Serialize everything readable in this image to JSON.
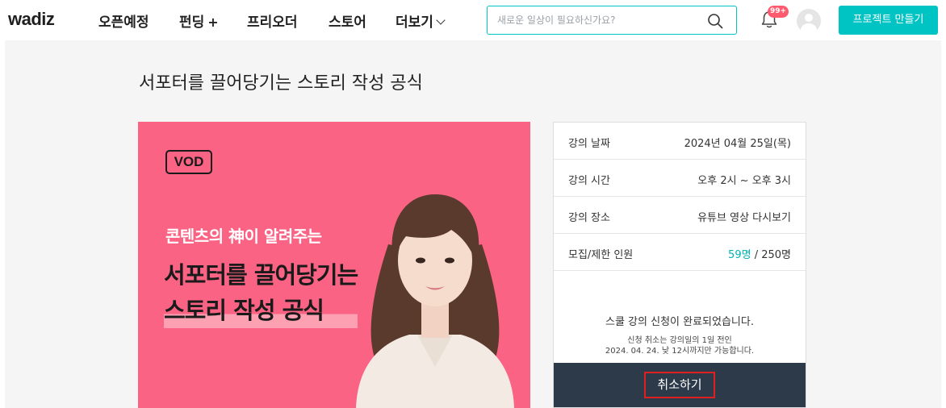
{
  "header": {
    "logo": "wadiz",
    "nav": [
      {
        "label": "오픈예정"
      },
      {
        "label": "펀딩"
      },
      {
        "label": "프리오더"
      },
      {
        "label": "스토어"
      },
      {
        "label": "더보기"
      }
    ],
    "funding_plus": "+",
    "search": {
      "placeholder": "새로운 일상이 필요하신가요?",
      "value": ""
    },
    "notification_badge": "99+",
    "create_button": "프로젝트 만들기"
  },
  "page": {
    "title": "서포터를 끌어당기는 스토리 작성 공식"
  },
  "banner": {
    "tag": "VOD",
    "subheadline": "콘텐츠의 神이 알려주는",
    "headline_line1": "서포터를 끌어당기는",
    "headline_line2": "스토리 작성 공식"
  },
  "lecture_info": {
    "rows": [
      {
        "label": "강의 날짜",
        "value": "2024년 04월 25일(목)"
      },
      {
        "label": "강의 시간",
        "value": "오후 2시 ~ 오후 3시"
      },
      {
        "label": "강의 장소",
        "value": "유튜브 영상 다시보기"
      },
      {
        "label": "모집/제한 인원",
        "value_current": "59명",
        "value_sep": " / ",
        "value_limit": "250명"
      }
    ],
    "notice_main": "스쿨 강의 신청이 완료되었습니다.",
    "notice_sub1": "신청 취소는 강의일의 1일 전인",
    "notice_sub2": "2024. 04. 24. 낮 12시까지만 가능합니다.",
    "cancel_button": "취소하기"
  },
  "colors": {
    "brand": "#00c4c4",
    "banner_bg": "#fa6383",
    "cancel_bg": "#2d3a4a",
    "accent_count": "#00b2b2",
    "badge": "#ff5b6e"
  }
}
